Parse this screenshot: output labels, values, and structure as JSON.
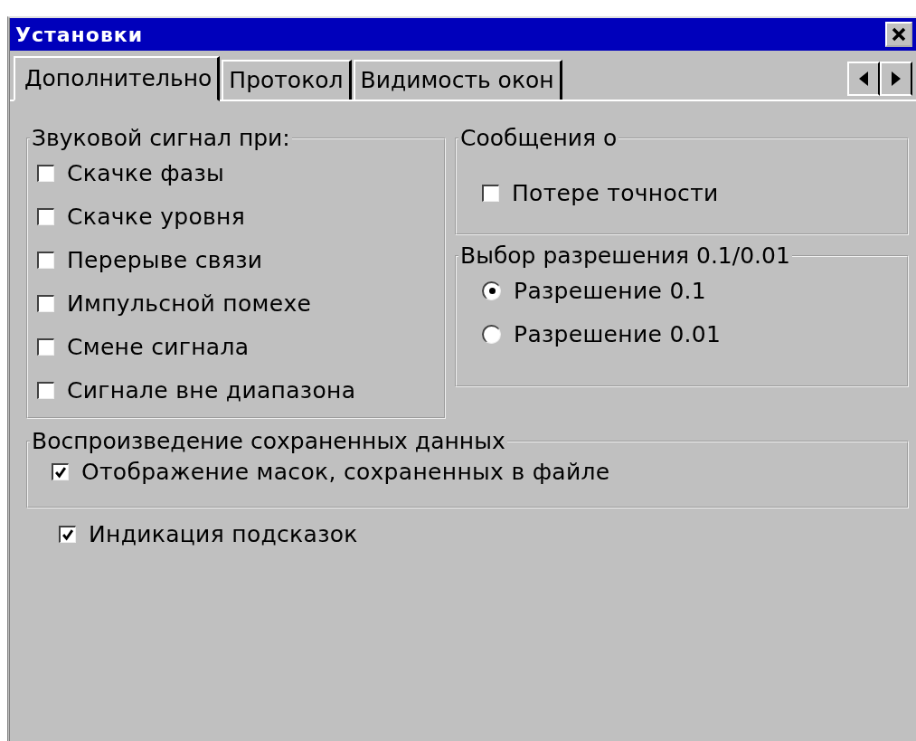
{
  "window": {
    "title": "Установки"
  },
  "tabs": [
    {
      "label": "Дополнительно",
      "selected": true
    },
    {
      "label": "Протокол",
      "selected": false
    },
    {
      "label": "Видимость окон",
      "selected": false
    }
  ],
  "sound_group": {
    "title": "Звуковой сигнал при:",
    "items": [
      {
        "label": "Скачке фазы",
        "checked": false
      },
      {
        "label": "Скачке уровня",
        "checked": false
      },
      {
        "label": "Перерыве связи",
        "checked": false
      },
      {
        "label": "Импульсной помехе",
        "checked": false
      },
      {
        "label": "Смене сигнала",
        "checked": false
      },
      {
        "label": "Сигнале вне диапазона",
        "checked": false
      }
    ]
  },
  "messages_group": {
    "title": "Сообщения о",
    "items": [
      {
        "label": "Потере точности",
        "checked": false
      }
    ]
  },
  "resolution_group": {
    "title": "Выбор разрешения 0.1/0.01",
    "options": [
      {
        "label": "Разрешение 0.1",
        "selected": true
      },
      {
        "label": "Разрешение 0.01",
        "selected": false
      }
    ]
  },
  "playback_group": {
    "title": "Воспроизведение сохраненных данных",
    "items": [
      {
        "label": "Отображение масок, сохраненных в файле",
        "checked": true
      }
    ]
  },
  "hints": {
    "label": "Индикация подсказок",
    "checked": true
  }
}
